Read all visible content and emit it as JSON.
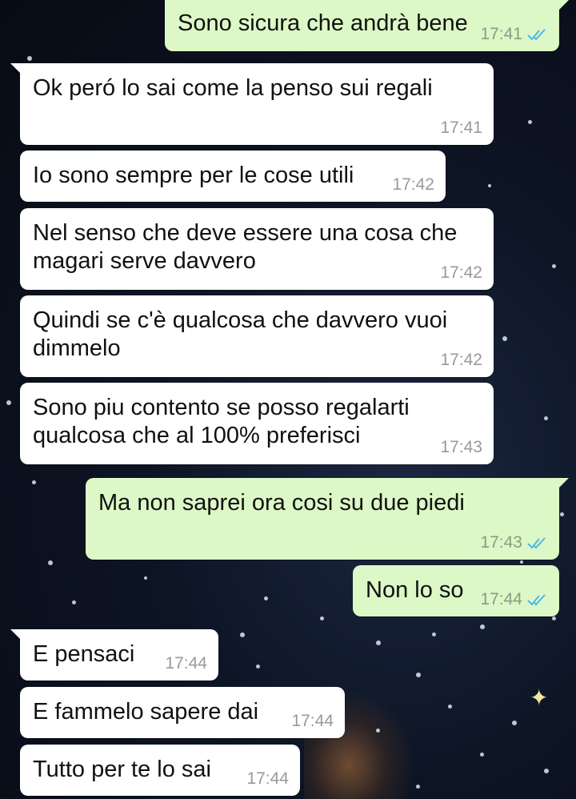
{
  "messages": [
    {
      "dir": "out",
      "text": "Sono sicura che andrà bene",
      "time": "17:41",
      "status": "read"
    },
    {
      "dir": "in",
      "text": "Ok peró lo sai come la penso sui regali",
      "time": "17:41"
    },
    {
      "dir": "in",
      "text": "Io sono sempre per le cose utili",
      "time": "17:42"
    },
    {
      "dir": "in",
      "text": "Nel senso che deve essere una cosa che\nmagari serve davvero",
      "time": "17:42"
    },
    {
      "dir": "in",
      "text": "Quindi se c'è qualcosa che davvero vuoi\ndimmelo",
      "time": "17:42"
    },
    {
      "dir": "in",
      "text": "Sono piu contento se posso regalarti\nqualcosa che al 100% preferisci",
      "time": "17:43"
    },
    {
      "dir": "out",
      "text": "Ma non saprei ora cosi su due piedi",
      "time": "17:43",
      "status": "read"
    },
    {
      "dir": "out",
      "text": "Non lo so",
      "time": "17:44",
      "status": "read"
    },
    {
      "dir": "in",
      "text": "E pensaci",
      "time": "17:44"
    },
    {
      "dir": "in",
      "text": "E fammelo sapere dai",
      "time": "17:44"
    },
    {
      "dir": "in",
      "text": "Tutto per te lo sai",
      "time": "17:44"
    }
  ],
  "colors": {
    "incoming": "#ffffff",
    "outgoing": "#dcf8c6",
    "read_tick": "#4fb6ec"
  },
  "icons": {
    "read_receipt": "double-check-icon"
  }
}
